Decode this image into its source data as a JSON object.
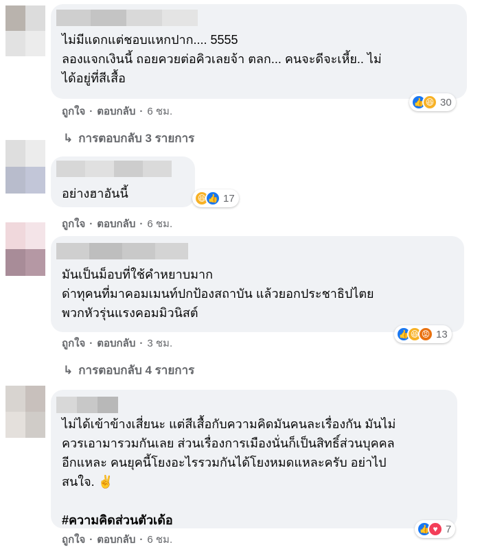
{
  "comments": [
    {
      "text": "ไม่มีแดกแต่ชอบแหกปาก.... 5555\nลองแจกเงินนี้ ถอยควยต่อคิวเลยจ้า ตลก... คนจะดีจะเหี้ย.. ไม่\nได้อยู่ที่สีเสื้อ",
      "like": "ถูกใจ",
      "reply": "ตอบกลับ",
      "time": "6 ชม.",
      "reactions": [
        "like-icon",
        "haha-icon"
      ],
      "reaction_count": "30",
      "replies_label": "การตอบกลับ 3 รายการ"
    },
    {
      "text": "อย่างฮาอันนี้",
      "like": "ถูกใจ",
      "reply": "ตอบกลับ",
      "time": "6 ชม.",
      "reactions": [
        "haha-icon",
        "like-icon"
      ],
      "reaction_count": "17"
    },
    {
      "text": "มันเป็นม็อบที่ใช้คำหยาบมาก\nด่าทุคนที่มาคอมเมนท์ปกป้องสถาบัน แล้วยอกประชาธิปไตย\nพวกหัวรุ่นแรงคอมมิวนิสต์",
      "like": "ถูกใจ",
      "reply": "ตอบกลับ",
      "time": "3 ชม.",
      "reactions": [
        "like-icon",
        "haha-icon",
        "angry-icon"
      ],
      "reaction_count": "13",
      "replies_label": "การตอบกลับ 4 รายการ"
    },
    {
      "text": "ไม่ได้เข้าข้างเสี่ยนะ แต่สีเสื้อกับความคิดมันคนละเรื่องกัน มันไม่\nควรเอามารวมกันเลย ส่วนเรื่องการเมืองนั่นก็เป็นสิทธิ์ส่วนบุคคล\nอีกแหละ คนยุคนี้โยงอะไรรวมกันได้โยงหมดแหละครับ อย่าไป\nสนใจ. ✌️",
      "hashtag": "#ความคิดส่วนตัวเด้อ",
      "like": "ถูกใจ",
      "reply": "ตอบกลับ",
      "time": "6 ชม.",
      "reactions": [
        "like-icon",
        "love-icon"
      ],
      "reaction_count": "7"
    }
  ],
  "colors": {
    "bubble": "#f0f2f5",
    "meta_text": "#65676b",
    "like_blue": "#1877f2",
    "haha_yellow": "#f7b125",
    "angry_orange": "#e9710f",
    "love_red": "#f33e58"
  }
}
